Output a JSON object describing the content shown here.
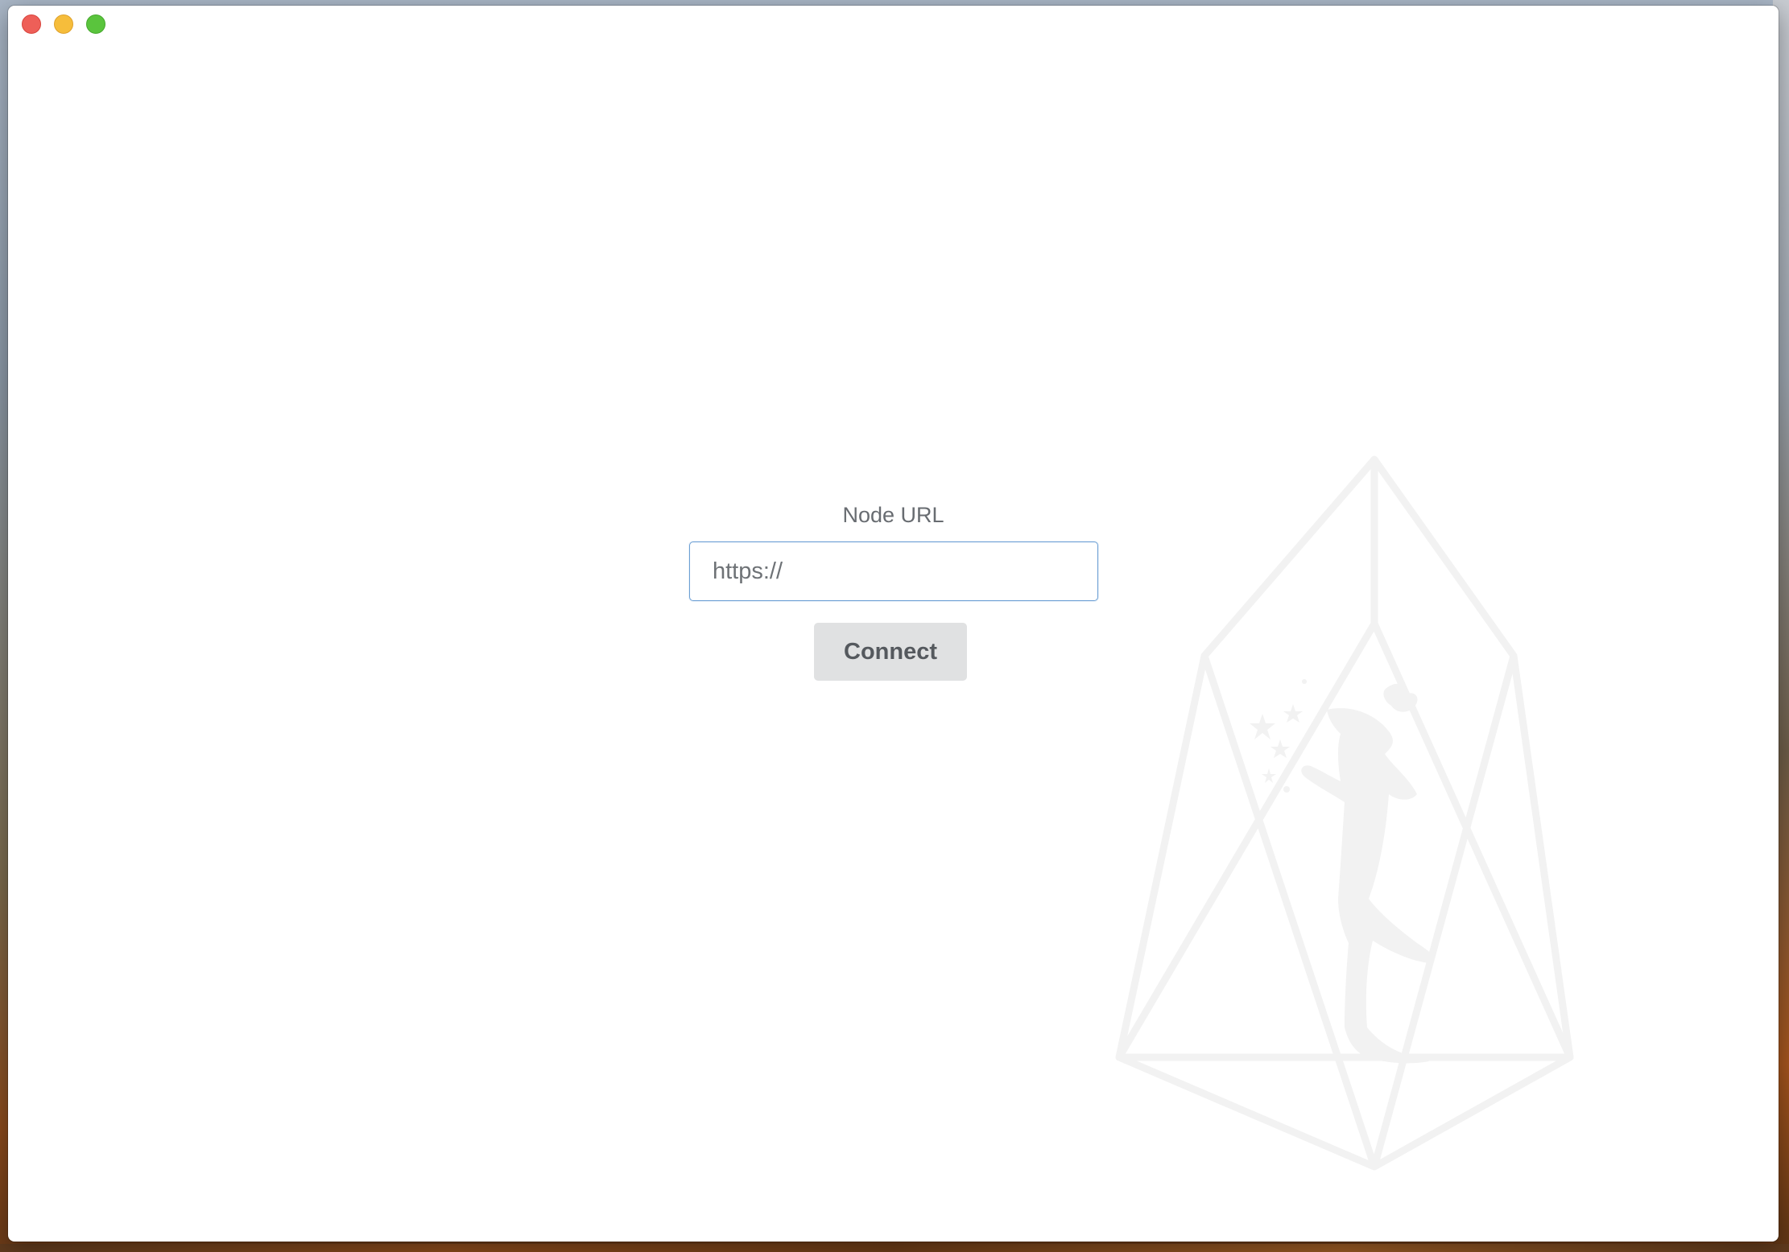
{
  "window": {
    "controls": {
      "close_icon": "close-icon",
      "minimize_icon": "minimize-icon",
      "maximize_icon": "maximize-icon"
    }
  },
  "form": {
    "label": "Node URL",
    "url_input": {
      "value": "",
      "placeholder": "https://"
    },
    "connect_label": "Connect"
  },
  "background": {
    "logo_icon": "eos-fairy-crystal-icon"
  },
  "colors": {
    "accent_border": "#6c9fd4",
    "button_bg": "#e0e1e2",
    "label_text": "#686c71",
    "watermark": "#f2f2f2",
    "close": "#ee5f58",
    "minimize": "#f6bd3b",
    "maximize": "#5ac43d"
  }
}
